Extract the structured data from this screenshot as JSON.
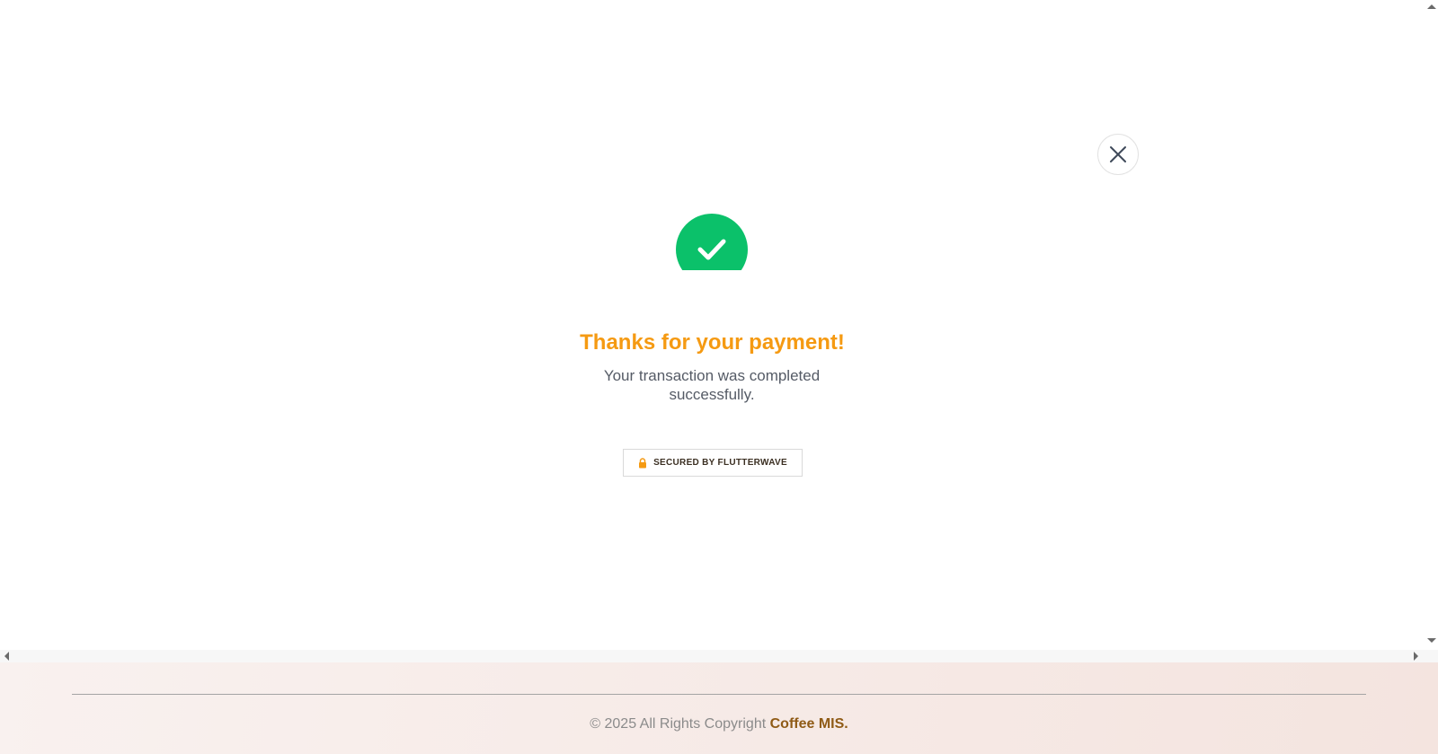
{
  "modal": {
    "close_icon": "close-icon",
    "status_icon": "checkmark-icon",
    "title": "Thanks for your payment!",
    "subtitle": "Your transaction was completed successfully.",
    "secured_badge": {
      "icon": "lock-icon",
      "label": "SECURED BY FLUTTERWAVE"
    }
  },
  "footer": {
    "copyright_text": "© 2025 All Rights Copyright",
    "brand": "Coffee MIS."
  },
  "colors": {
    "accent": "#f59a12",
    "success": "#0bc16a",
    "brand": "#8f5b16"
  }
}
